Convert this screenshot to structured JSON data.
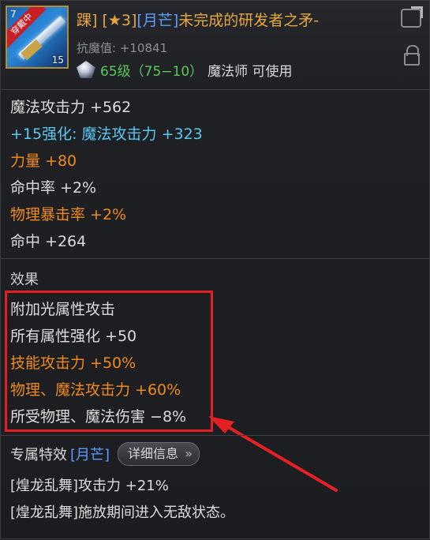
{
  "header": {
    "icon_ribbon": "穿戴中",
    "icon_rank": "7",
    "icon_count": "15",
    "title_prefix": "踝] ",
    "title_star": "[★3]",
    "title_tag": "[月芒]",
    "title_name": "未完成的研发者之矛-",
    "anti_magic": "抗魔值: +10841",
    "level": "65级（75−10）",
    "usable": "魔法师 可使用"
  },
  "stats": [
    {
      "text": "魔法攻击力 +562",
      "color": "white"
    },
    {
      "text": "+15强化: 魔法攻击力 +323",
      "color": "cyan"
    },
    {
      "text": "力量 +80",
      "color": "orange"
    },
    {
      "text": "命中率 +2%",
      "color": "white"
    },
    {
      "text": "物理暴击率 +2%",
      "color": "orange"
    },
    {
      "text": "命中 +264",
      "color": "white"
    }
  ],
  "effects": {
    "title": "效果",
    "items": [
      {
        "text": "附加光属性攻击",
        "color": "white"
      },
      {
        "text": "所有属性强化 +50",
        "color": "white"
      },
      {
        "text": "技能攻击力 +50%",
        "color": "orange"
      },
      {
        "text": "物理、魔法攻击力 +60%",
        "color": "orange"
      },
      {
        "text": "所受物理、魔法伤害 −8%",
        "color": "white"
      }
    ]
  },
  "exclusive": {
    "label": "专属特效",
    "tag": "[月芒]",
    "detail_button": "详细信息",
    "lines": [
      "[煌龙乱舞]攻击力 +21%",
      "[煌龙乱舞]施放期间进入无敌状态。"
    ]
  },
  "colors": {
    "title": "#e8a640",
    "moon": "#5a9cff",
    "level": "#58c95a",
    "orange": "#f08a1e",
    "cyan": "#58c9f2",
    "highlight_box": "#e52025"
  }
}
